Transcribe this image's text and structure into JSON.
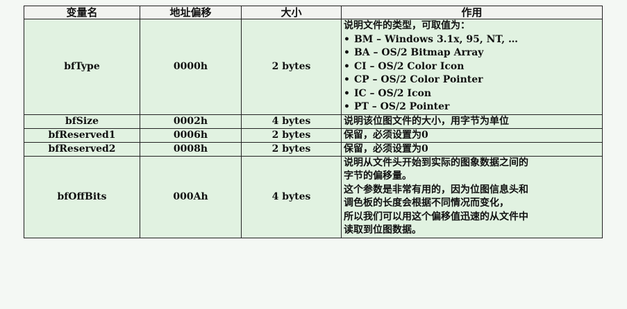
{
  "table": {
    "headers": [
      "变量名",
      "地址偏移",
      "大小",
      "作用"
    ],
    "rows": [
      {
        "name": "bfType",
        "offset": "0000h",
        "size": "2 bytes",
        "desc_lines": [
          "说明文件的类型，可取值为："
        ],
        "desc_list": [
          "BM – Windows 3.1x, 95, NT, …",
          "BA – OS/2 Bitmap Array",
          "CI – OS/2 Color Icon",
          "CP – OS/2 Color Pointer",
          "IC – OS/2 Icon",
          "PT – OS/2 Pointer"
        ]
      },
      {
        "name": "bfSize",
        "offset": "0002h",
        "size": "4 bytes",
        "desc_lines": [
          "说明该位图文件的大小，用字节为单位"
        ]
      },
      {
        "name": "bfReserved1",
        "offset": "0006h",
        "size": "2 bytes",
        "desc_lines": [
          "保留，必须设置为0"
        ]
      },
      {
        "name": "bfReserved2",
        "offset": "0008h",
        "size": "2 bytes",
        "desc_lines": [
          "保留，必须设置为0"
        ]
      },
      {
        "name": "bfOffBits",
        "offset": "000Ah",
        "size": "4 bytes",
        "desc_lines": [
          "说明从文件头开始到实际的图象数据之间的",
          "字节的偏移量。",
          "这个参数是非常有用的，因为位图信息头和",
          "调色板的长度会根据不同情况而变化，",
          "所以我们可以用这个偏移值迅速的从文件中",
          "读取到位图数据。"
        ]
      }
    ]
  }
}
